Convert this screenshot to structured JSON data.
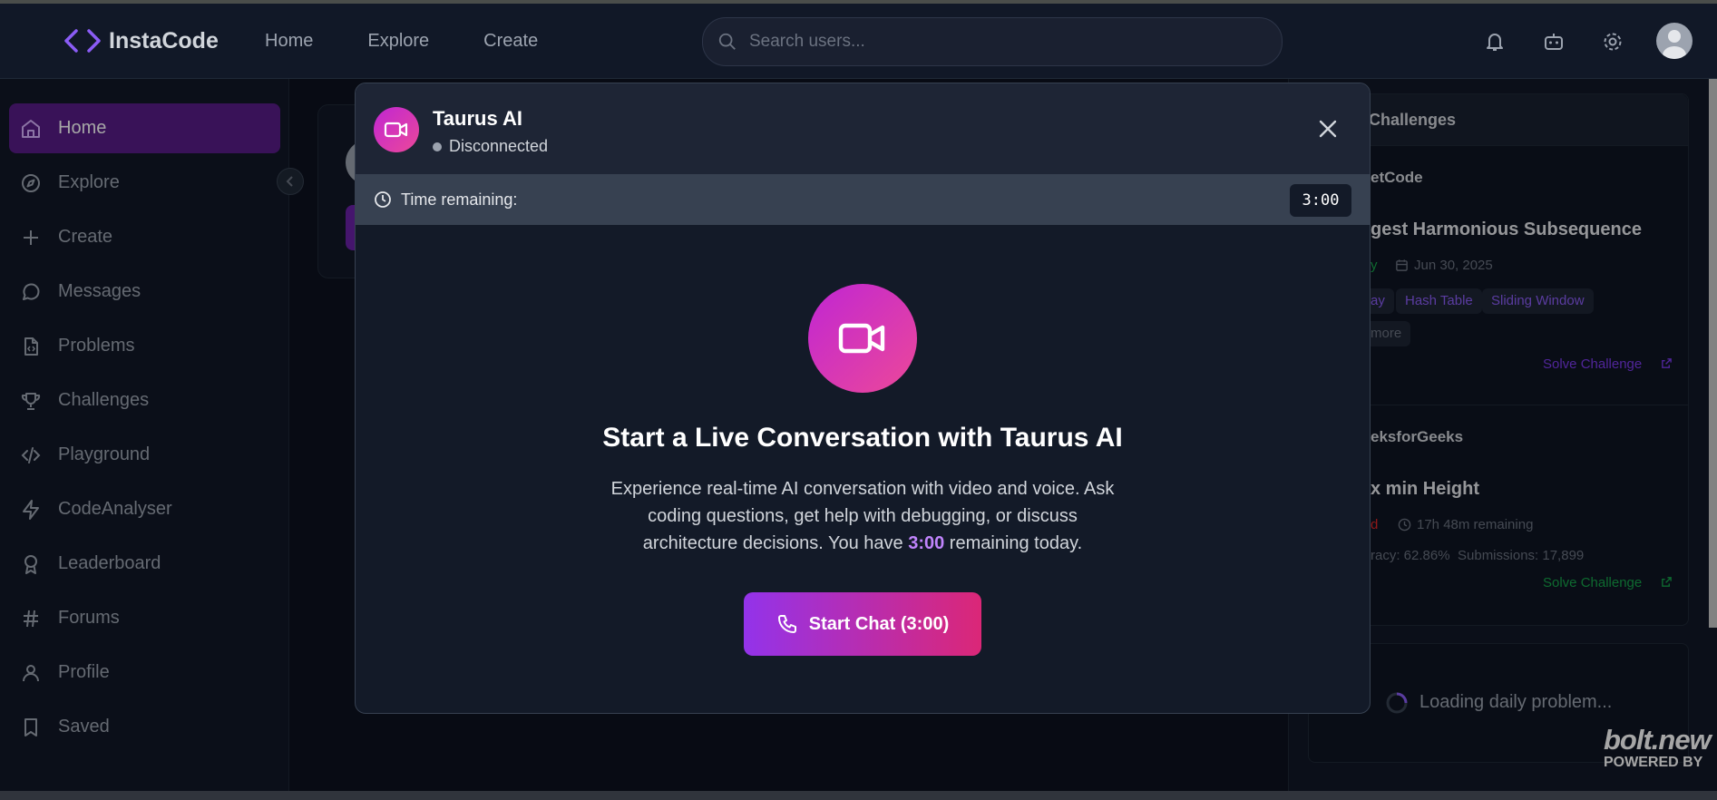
{
  "app": {
    "logo_text": "InstaCode",
    "nav": [
      "Home",
      "Explore",
      "Create"
    ],
    "search_placeholder": "Search users..."
  },
  "sidebar": {
    "items": [
      {
        "label": "Home",
        "icon": "home-icon",
        "active": true
      },
      {
        "label": "Explore",
        "icon": "compass-icon"
      },
      {
        "label": "Create",
        "icon": "plus-icon"
      },
      {
        "label": "Messages",
        "icon": "message-icon"
      },
      {
        "label": "Problems",
        "icon": "file-code-icon"
      },
      {
        "label": "Challenges",
        "icon": "trophy-icon"
      },
      {
        "label": "Playground",
        "icon": "code-icon"
      },
      {
        "label": "CodeAnalyser",
        "icon": "zap-icon"
      },
      {
        "label": "Leaderboard",
        "icon": "award-icon"
      },
      {
        "label": "Forums",
        "icon": "hash-icon"
      },
      {
        "label": "Profile",
        "icon": "user-icon"
      },
      {
        "label": "Saved",
        "icon": "bookmark-icon"
      }
    ]
  },
  "right_panel": {
    "title": "Challenges",
    "leetcode": {
      "source": "etCode",
      "problem": "gest Harmonious Subsequence",
      "difficulty": "y",
      "date": "Jun 30, 2025",
      "tags": [
        "ay",
        "Hash Table",
        "Sliding Window"
      ],
      "more": "more",
      "solve": "Solve Challenge"
    },
    "gfg": {
      "source": "eksforGeeks",
      "problem": "x min Height",
      "difficulty": "d",
      "remaining": "17h 48m remaining",
      "accuracy": "racy: 62.86%",
      "submissions": "Submissions: 17,899",
      "solve": "Solve Challenge"
    },
    "loading": "Loading daily problem..."
  },
  "watermark": {
    "brand": "bolt.new",
    "tagline": "POWERED BY"
  },
  "modal": {
    "title": "Taurus AI",
    "status": "Disconnected",
    "time_label": "Time remaining:",
    "time_value": "3:00",
    "heading": "Start a Live Conversation with Taurus AI",
    "desc_before": "Experience real-time AI conversation with video and voice. Ask coding questions, get help with debugging, or discuss architecture decisions. You have ",
    "desc_highlight": "3:00",
    "desc_after": " remaining today.",
    "button": "Start Chat (3:00)"
  },
  "colors": {
    "accent": "#9333ea",
    "pink": "#db2777",
    "highlight": "#c084fc"
  }
}
